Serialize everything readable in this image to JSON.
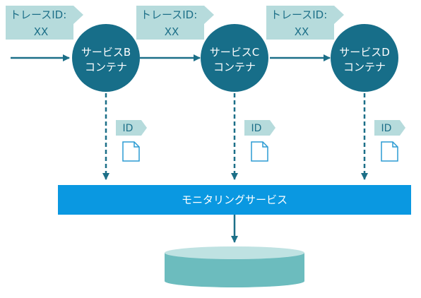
{
  "services": [
    {
      "name": "サービスB",
      "kind": "コンテナ",
      "trace_label": "トレースID:",
      "trace_value": "XX",
      "id_label": "ID"
    },
    {
      "name": "サービスC",
      "kind": "コンテナ",
      "trace_label": "トレースID:",
      "trace_value": "XX",
      "id_label": "ID"
    },
    {
      "name": "サービスD",
      "kind": "コンテナ",
      "trace_label": "トレースID:",
      "trace_value": "XX",
      "id_label": "ID"
    }
  ],
  "monitoring": {
    "label": "モニタリングサービス"
  },
  "colors": {
    "circle": "#176e89",
    "tag": "#b6dbdc",
    "bar": "#0a98e1",
    "arrow": "#1c6f88",
    "cylinder_body": "#6cbcbe",
    "cylinder_top": "#bfe2e2",
    "doc_outline": "#2b9bd3"
  }
}
